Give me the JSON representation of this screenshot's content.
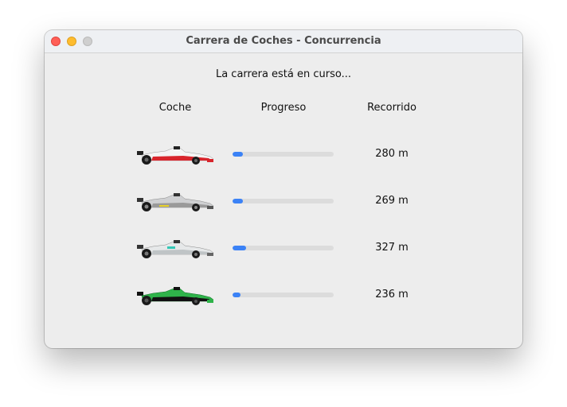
{
  "window": {
    "title": "Carrera de Coches - Concurrencia"
  },
  "status_text": "La carrera está en curso...",
  "table": {
    "headers": [
      "Coche",
      "Progreso",
      "Recorrido"
    ],
    "rows": [
      {
        "car_icon": "f1-car-red-white-icon",
        "car_color": "#d8252c",
        "progress": 0.1,
        "distance": "280 m"
      },
      {
        "car_icon": "f1-car-silver-yellow-icon",
        "car_color": "#cfd0d2",
        "progress": 0.1,
        "distance": "269 m"
      },
      {
        "car_icon": "f1-car-silver-teal-icon",
        "car_color": "#bfc4c6",
        "progress": 0.13,
        "distance": "327 m"
      },
      {
        "car_icon": "f1-car-green-black-icon",
        "car_color": "#2fb34a",
        "progress": 0.08,
        "distance": "236 m"
      }
    ]
  },
  "colors": {
    "progress_fill": "#3b82f6",
    "progress_track": "#dcdcdc"
  }
}
